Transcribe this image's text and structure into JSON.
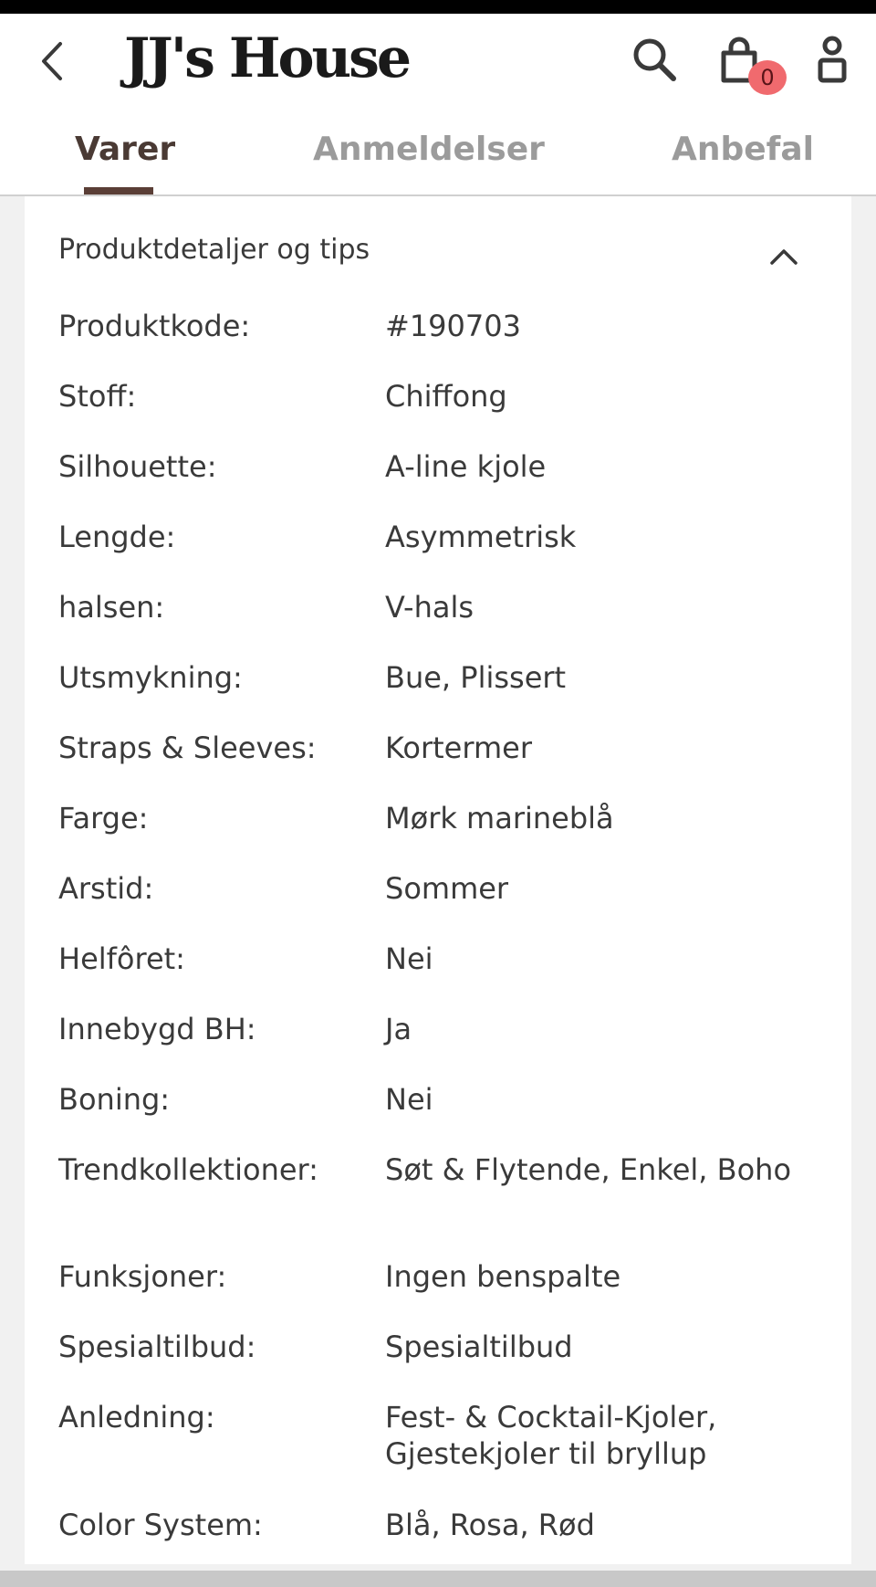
{
  "header": {
    "logo_text": "JJ's House",
    "cart_count": "0",
    "icons": [
      "chevron-left-icon",
      "search-icon",
      "shopping-bag-icon",
      "user-icon"
    ]
  },
  "tabs": [
    {
      "label": "Varer",
      "active": true
    },
    {
      "label": "Anmeldelser",
      "active": false
    },
    {
      "label": "Anbefal",
      "active": false
    }
  ],
  "section": {
    "title": "Produktdetaljer og tips",
    "expanded": true,
    "rows": [
      {
        "label": "Produktkode:",
        "value": "#190703"
      },
      {
        "label": "Stoff:",
        "value": "Chiffong"
      },
      {
        "label": "Silhouette:",
        "value": "A-line kjole"
      },
      {
        "label": "Lengde:",
        "value": "Asymmetrisk"
      },
      {
        "label": "halsen:",
        "value": "V-hals"
      },
      {
        "label": "Utsmykning:",
        "value": "Bue, Plissert"
      },
      {
        "label": "Straps & Sleeves:",
        "value": "Kortermer"
      },
      {
        "label": "Farge:",
        "value": "Mørk marineblå"
      },
      {
        "label": "Arstid:",
        "value": "Sommer"
      },
      {
        "label": "Helfôret:",
        "value": "Nei"
      },
      {
        "label": "Innebygd BH:",
        "value": "Ja"
      },
      {
        "label": "Boning:",
        "value": "Nei"
      },
      {
        "label": "Trendkollektioner:",
        "value": "Søt & Flytende, Enkel, Boho"
      },
      {
        "label": "Funksjoner:",
        "value": "Ingen benspalte"
      },
      {
        "label": "Spesialtilbud:",
        "value": "Spesialtilbud"
      },
      {
        "label": "Anledning:",
        "value": "Fest- & Cocktail-Kjoler, Gjestekjoler til bryllup"
      },
      {
        "label": "Color System:",
        "value": "Blå, Rosa, Rød"
      }
    ]
  },
  "colors": {
    "accent": "#5a3e36",
    "badge": "#f06a6e",
    "text": "#3a3a3a",
    "tab_inactive": "#9b9b9b"
  }
}
